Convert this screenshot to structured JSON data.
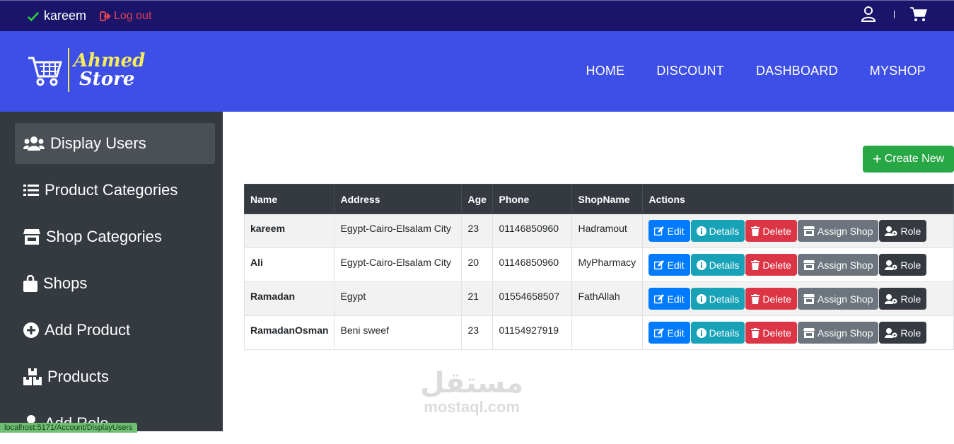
{
  "topbar": {
    "username": "kareem",
    "logout_label": "Log out"
  },
  "header": {
    "logo_line1": "Ahmed",
    "logo_line2": "Store",
    "nav": [
      "HOME",
      "DISCOUNT",
      "DASHBOARD",
      "MYSHOP"
    ]
  },
  "sidebar": {
    "items": [
      {
        "label": "Display Users",
        "icon": "users-icon",
        "active": true
      },
      {
        "label": "Product Categories",
        "icon": "list-icon"
      },
      {
        "label": "Shop Categories",
        "icon": "store-icon"
      },
      {
        "label": "Shops",
        "icon": "shopping-bag-icon"
      },
      {
        "label": "Add Product",
        "icon": "plus-circle-icon"
      },
      {
        "label": "Products",
        "icon": "boxes-icon"
      },
      {
        "label": "Add Role",
        "icon": "user-icon"
      }
    ]
  },
  "status_url": "localhost:5171/Account/DisplayUsers",
  "main": {
    "create_label": "Create New",
    "columns": [
      "Name",
      "Address",
      "Age",
      "Phone",
      "ShopName",
      "Actions"
    ],
    "rows": [
      {
        "name": "kareem",
        "address": "Egypt-Cairo-Elsalam City",
        "age": "23",
        "phone": "01146850960",
        "shop": "Hadramout"
      },
      {
        "name": "Ali",
        "address": "Egypt-Cairo-Elsalam City",
        "age": "20",
        "phone": "01146850960",
        "shop": "MyPharmacy"
      },
      {
        "name": "Ramadan",
        "address": "Egypt",
        "age": "21",
        "phone": "01554658507",
        "shop": "FathAllah"
      },
      {
        "name": "RamadanOsman",
        "address": "Beni sweef",
        "age": "23",
        "phone": "01154927919",
        "shop": ""
      }
    ],
    "actions": {
      "edit": "Edit",
      "details": "Details",
      "delete": "Delete",
      "assign": "Assign Shop",
      "role": "Role"
    }
  },
  "watermark": {
    "arabic": "مستقل",
    "latin": "mostaql.com"
  }
}
